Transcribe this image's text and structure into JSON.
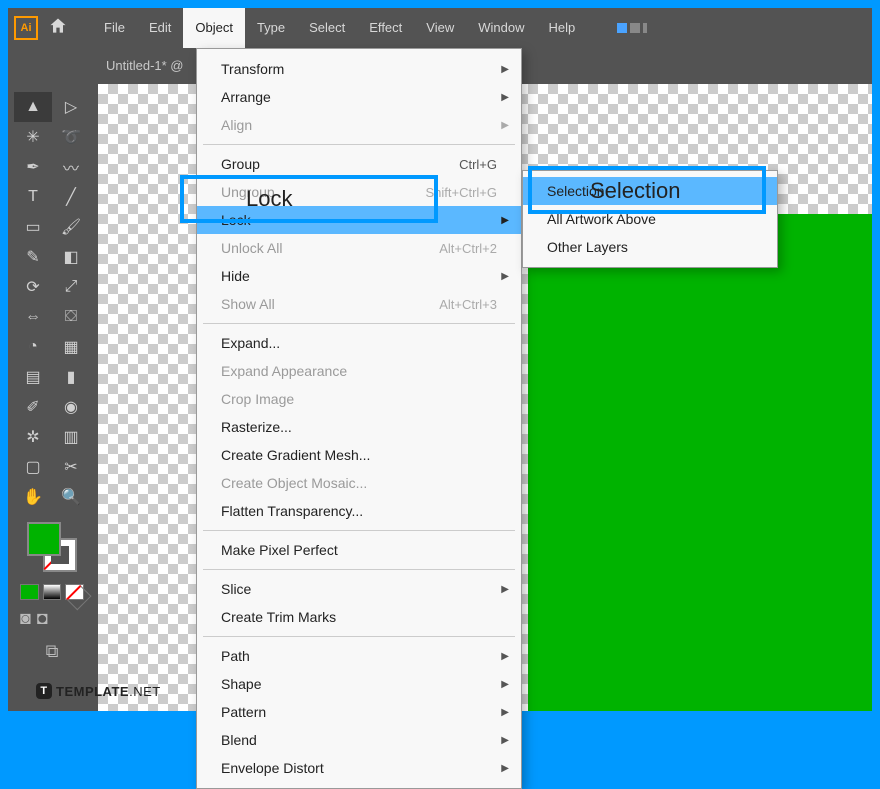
{
  "app_logo": "Ai",
  "menubar": [
    "File",
    "Edit",
    "Object",
    "Type",
    "Select",
    "Effect",
    "View",
    "Window",
    "Help"
  ],
  "active_menu_index": 2,
  "document_tab": "Untitled-1* @",
  "object_menu": {
    "groups": [
      [
        {
          "label": "Transform",
          "sub": true
        },
        {
          "label": "Arrange",
          "sub": true
        },
        {
          "label": "Align",
          "sub": true,
          "disabled": true
        }
      ],
      [
        {
          "label": "Group",
          "shortcut": "Ctrl+G"
        },
        {
          "label": "Ungroup",
          "shortcut": "Shift+Ctrl+G",
          "disabled": true
        },
        {
          "label": "Lock",
          "sub": true,
          "highlight": true
        },
        {
          "label": "Unlock All",
          "shortcut": "Alt+Ctrl+2",
          "disabled": true
        },
        {
          "label": "Hide",
          "sub": true
        },
        {
          "label": "Show All",
          "shortcut": "Alt+Ctrl+3",
          "disabled": true
        }
      ],
      [
        {
          "label": "Expand..."
        },
        {
          "label": "Expand Appearance",
          "disabled": true
        },
        {
          "label": "Crop Image",
          "disabled": true
        },
        {
          "label": "Rasterize..."
        },
        {
          "label": "Create Gradient Mesh..."
        },
        {
          "label": "Create Object Mosaic...",
          "disabled": true
        },
        {
          "label": "Flatten Transparency..."
        }
      ],
      [
        {
          "label": "Make Pixel Perfect"
        }
      ],
      [
        {
          "label": "Slice",
          "sub": true
        },
        {
          "label": "Create Trim Marks"
        }
      ],
      [
        {
          "label": "Path",
          "sub": true
        },
        {
          "label": "Shape",
          "sub": true
        },
        {
          "label": "Pattern",
          "sub": true
        },
        {
          "label": "Blend",
          "sub": true
        },
        {
          "label": "Envelope Distort",
          "sub": true
        }
      ]
    ]
  },
  "lock_submenu": [
    "Selection",
    "All Artwork Above",
    "Other Layers"
  ],
  "highlight_labels": {
    "lock": "Lock",
    "selection": "Selection"
  },
  "colors": {
    "accent": "#0099ff",
    "canvas_shape": "#00b300"
  },
  "watermark": {
    "badge": "T",
    "text1": "TEMPLATE",
    "text2": ".NET"
  }
}
